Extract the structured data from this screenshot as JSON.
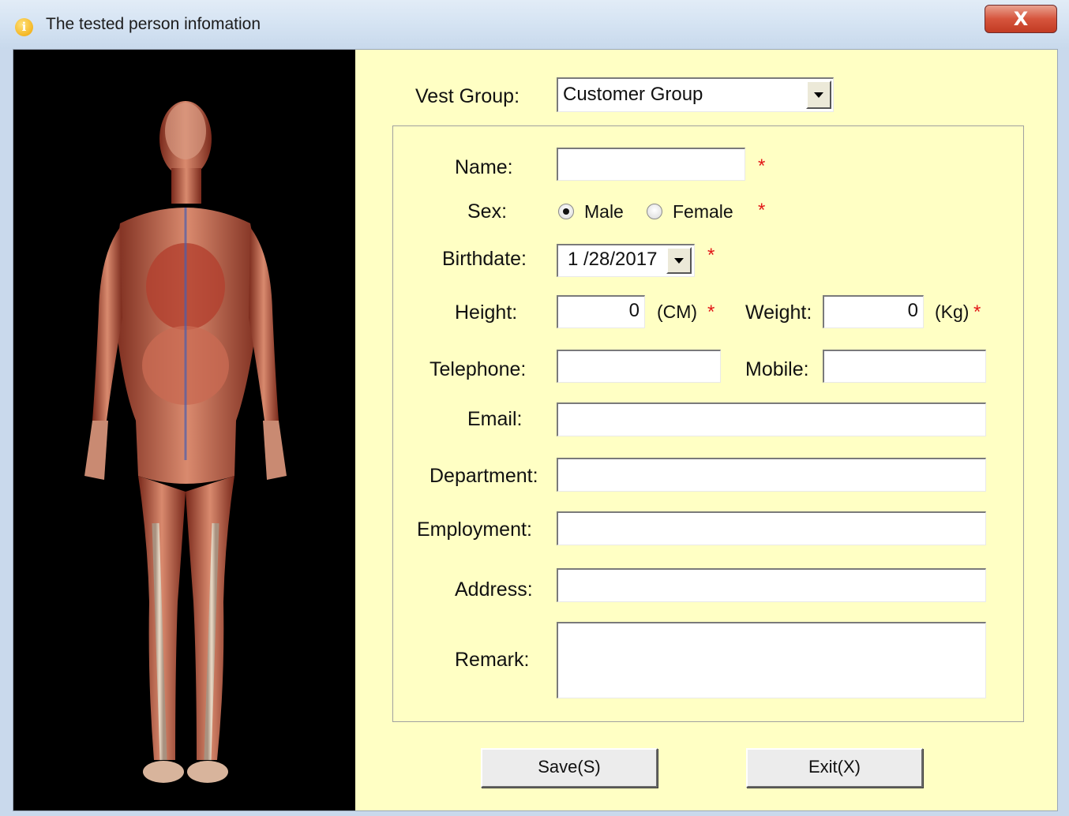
{
  "window": {
    "title": "The tested person infomation",
    "close_label": "X"
  },
  "form": {
    "vest_group": {
      "label": "Vest Group:",
      "value": "Customer Group"
    },
    "name": {
      "label": "Name:",
      "value": "",
      "required": "*"
    },
    "sex": {
      "label": "Sex:",
      "options": [
        "Male",
        "Female"
      ],
      "selected": "Male",
      "required": "*"
    },
    "birthdate": {
      "label": "Birthdate:",
      "value": "1 /28/2017",
      "required": "*"
    },
    "height": {
      "label": "Height:",
      "value": "0",
      "unit": "(CM)",
      "required": "*"
    },
    "weight": {
      "label": "Weight:",
      "value": "0",
      "unit": "(Kg)",
      "required": "*"
    },
    "telephone": {
      "label": "Telephone:",
      "value": ""
    },
    "mobile": {
      "label": "Mobile:",
      "value": ""
    },
    "email": {
      "label": "Email:",
      "value": ""
    },
    "department": {
      "label": "Department:",
      "value": ""
    },
    "employment": {
      "label": "Employment:",
      "value": ""
    },
    "address": {
      "label": "Address:",
      "value": ""
    },
    "remark": {
      "label": "Remark:",
      "value": ""
    }
  },
  "buttons": {
    "save": "Save(S)",
    "exit": "Exit(X)"
  },
  "colors": {
    "form_background": "#ffffc4",
    "required_marker": "#e21818",
    "image_background": "#000000"
  }
}
